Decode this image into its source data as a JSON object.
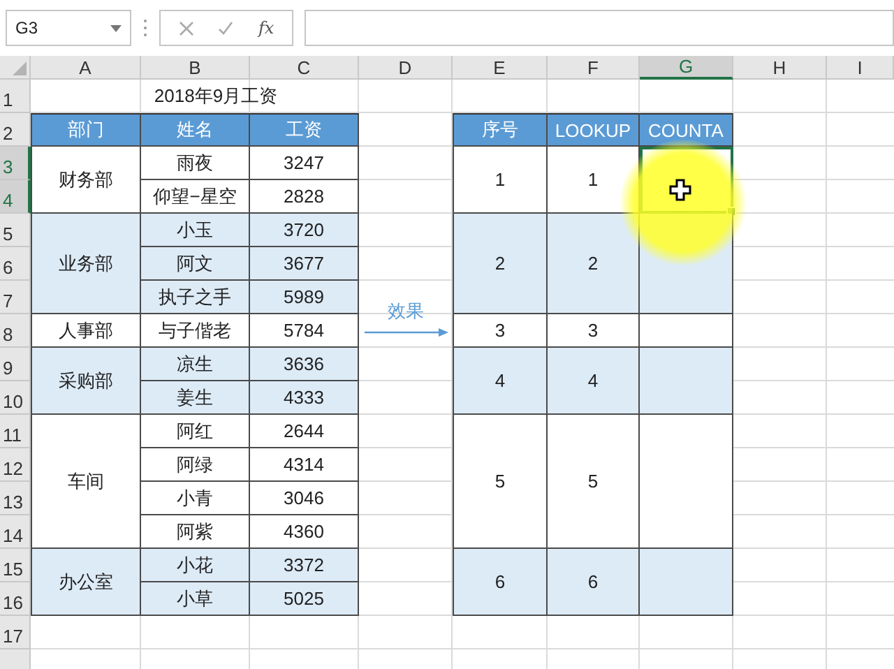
{
  "name_box": "G3",
  "formula_bar": {
    "fx": "fx"
  },
  "columns": [
    {
      "label": "A",
      "selected": false
    },
    {
      "label": "B",
      "selected": false
    },
    {
      "label": "C",
      "selected": false
    },
    {
      "label": "D",
      "selected": false
    },
    {
      "label": "E",
      "selected": false
    },
    {
      "label": "F",
      "selected": false
    },
    {
      "label": "G",
      "selected": true
    },
    {
      "label": "H",
      "selected": false
    },
    {
      "label": "I",
      "selected": false
    }
  ],
  "rows": [
    {
      "label": "1",
      "selected": false
    },
    {
      "label": "2",
      "selected": false
    },
    {
      "label": "3",
      "selected": true
    },
    {
      "label": "4",
      "selected": true
    },
    {
      "label": "5",
      "selected": false
    },
    {
      "label": "6",
      "selected": false
    },
    {
      "label": "7",
      "selected": false
    },
    {
      "label": "8",
      "selected": false
    },
    {
      "label": "9",
      "selected": false
    },
    {
      "label": "10",
      "selected": false
    },
    {
      "label": "11",
      "selected": false
    },
    {
      "label": "12",
      "selected": false
    },
    {
      "label": "13",
      "selected": false
    },
    {
      "label": "14",
      "selected": false
    },
    {
      "label": "15",
      "selected": false
    },
    {
      "label": "16",
      "selected": false
    },
    {
      "label": "17",
      "selected": false
    }
  ],
  "salary_table": {
    "title": "2018年9月工资",
    "headers": [
      "部门",
      "姓名",
      "工资"
    ],
    "departments": [
      {
        "name": "财务部",
        "shaded": false,
        "employees": [
          {
            "name": "雨夜",
            "salary": "3247"
          },
          {
            "name": "仰望−星空",
            "salary": "2828"
          }
        ]
      },
      {
        "name": "业务部",
        "shaded": true,
        "employees": [
          {
            "name": "小玉",
            "salary": "3720"
          },
          {
            "name": "阿文",
            "salary": "3677"
          },
          {
            "name": "执子之手",
            "salary": "5989"
          }
        ]
      },
      {
        "name": "人事部",
        "shaded": false,
        "employees": [
          {
            "name": "与子偕老",
            "salary": "5784"
          }
        ]
      },
      {
        "name": "采购部",
        "shaded": true,
        "employees": [
          {
            "name": "凉生",
            "salary": "3636"
          },
          {
            "name": "姜生",
            "salary": "4333"
          }
        ]
      },
      {
        "name": "车间",
        "shaded": false,
        "employees": [
          {
            "name": "阿红",
            "salary": "2644"
          },
          {
            "name": "阿绿",
            "salary": "4314"
          },
          {
            "name": "小青",
            "salary": "3046"
          },
          {
            "name": "阿紫",
            "salary": "4360"
          }
        ]
      },
      {
        "name": "办公室",
        "shaded": true,
        "employees": [
          {
            "name": "小花",
            "salary": "3372"
          },
          {
            "name": "小草",
            "salary": "5025"
          }
        ]
      }
    ]
  },
  "arrow_label": "效果",
  "result_table": {
    "headers": [
      "序号",
      "LOOKUP",
      "COUNTA"
    ],
    "rows": [
      {
        "number": "1",
        "lookup": "1",
        "shaded": false,
        "selected": true
      },
      {
        "number": "2",
        "lookup": "2",
        "shaded": true,
        "selected": false
      },
      {
        "number": "3",
        "lookup": "3",
        "shaded": false,
        "selected": false
      },
      {
        "number": "4",
        "lookup": "4",
        "shaded": true,
        "selected": false
      },
      {
        "number": "5",
        "lookup": "5",
        "shaded": false,
        "selected": false
      },
      {
        "number": "6",
        "lookup": "6",
        "shaded": true,
        "selected": false
      }
    ]
  }
}
